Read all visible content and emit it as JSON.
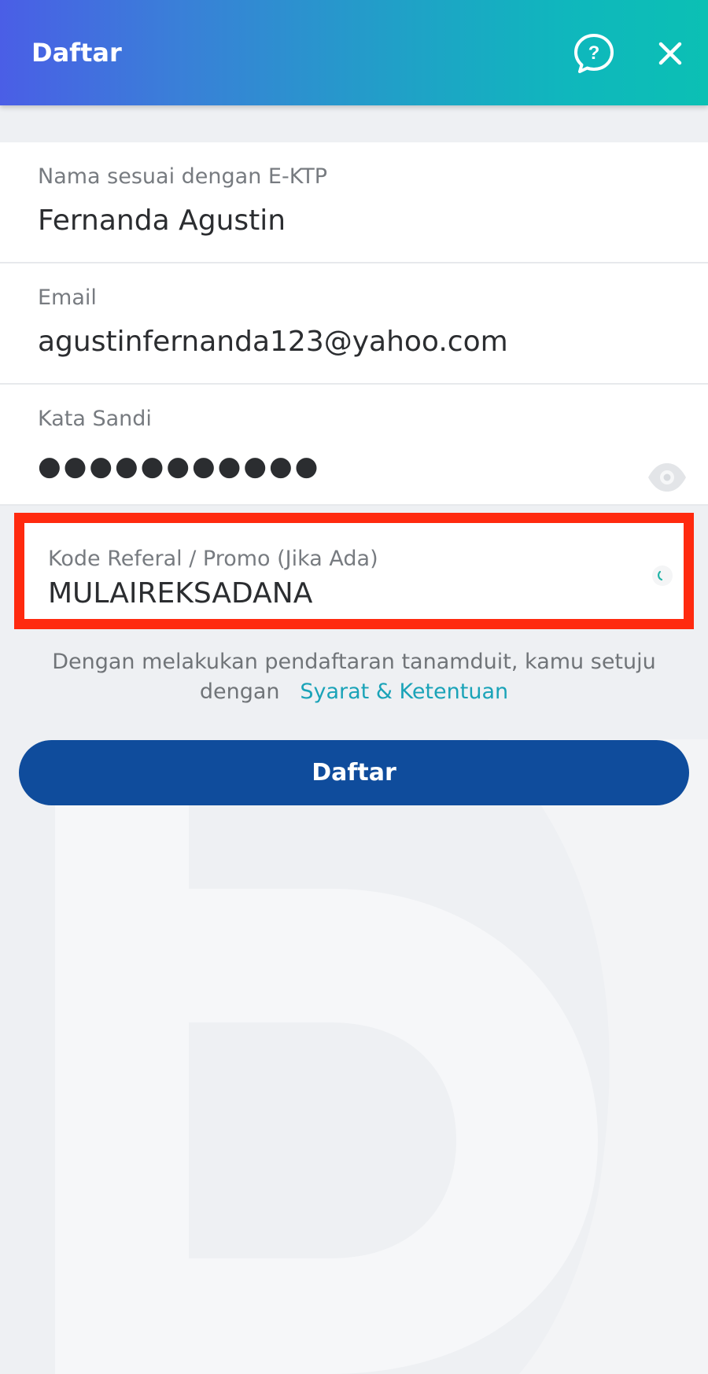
{
  "app_bar": {
    "title": "Daftar",
    "help_icon": "help-question-icon",
    "close_icon": "close-icon"
  },
  "form": {
    "name": {
      "label": "Nama sesuai dengan E-KTP",
      "value": "Fernanda Agustin"
    },
    "email": {
      "label": "Email",
      "value": "agustinfernanda123@yahoo.com"
    },
    "password": {
      "label": "Kata Sandi",
      "value": "●●●●●●●●●●●",
      "toggle_icon": "eye-icon"
    },
    "promo": {
      "label": "Kode Referal / Promo (Jika Ada)",
      "value": "MULAIREKSADANA",
      "status_icon": "loading-spinner-icon"
    }
  },
  "terms": {
    "text_line1": "Dengan melakukan pendaftaran tanamduit, kamu setuju",
    "text_line2": "dengan",
    "link": "Syarat & Ketentuan"
  },
  "submit": {
    "label": "Daftar"
  },
  "colors": {
    "header_gradient_start": "#4a5ee6",
    "header_gradient_end": "#0bc0b4",
    "button": "#0f4c9c",
    "link": "#1aa3b8",
    "highlight": "#ff2a0f",
    "background": "#eef0f3"
  }
}
